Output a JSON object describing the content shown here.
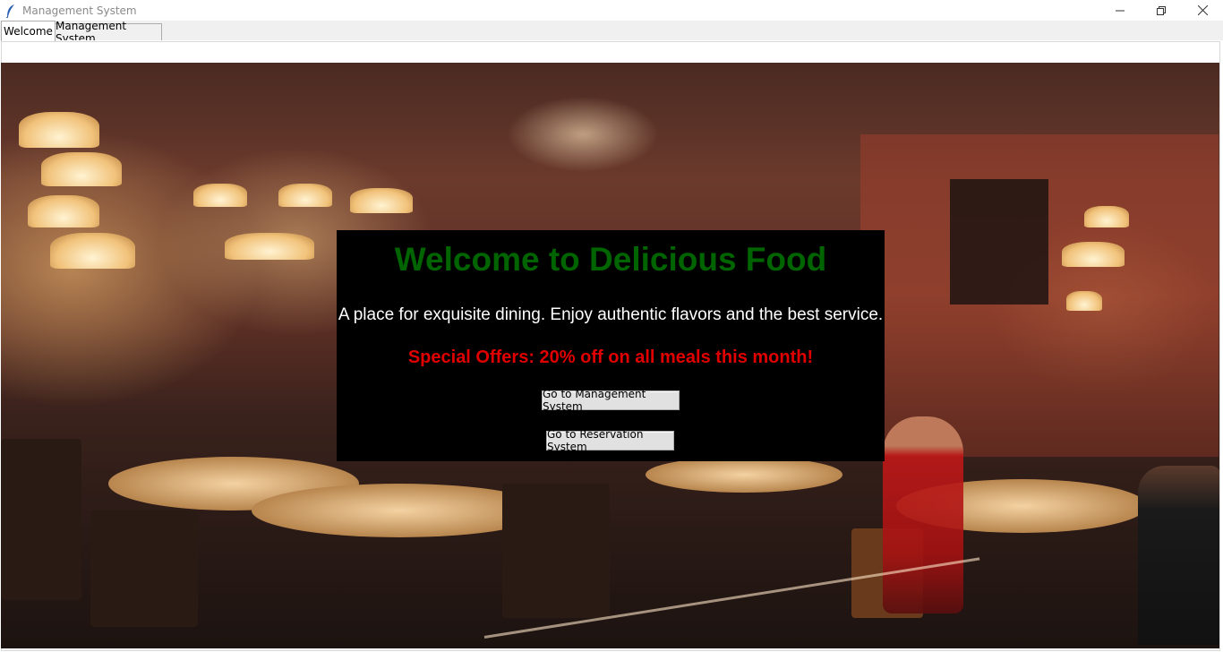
{
  "window": {
    "title": "Management System",
    "controls": [
      "minimize-icon",
      "restore-icon",
      "close-icon"
    ]
  },
  "tabs": [
    {
      "label": "Welcome",
      "active": true
    },
    {
      "label": "Management System",
      "active": false
    }
  ],
  "welcome": {
    "headline": "Welcome to Delicious Food",
    "tagline": "A place for exquisite dining. Enjoy authentic flavors and the best service.",
    "offer": "Special Offers: 20% off on all meals this month!",
    "buttons": {
      "management": "Go to Management System",
      "reservation": "Go to Reservation System"
    }
  },
  "colors": {
    "headline": "#006400",
    "offer": "#e00000",
    "overlay": "#000000"
  }
}
